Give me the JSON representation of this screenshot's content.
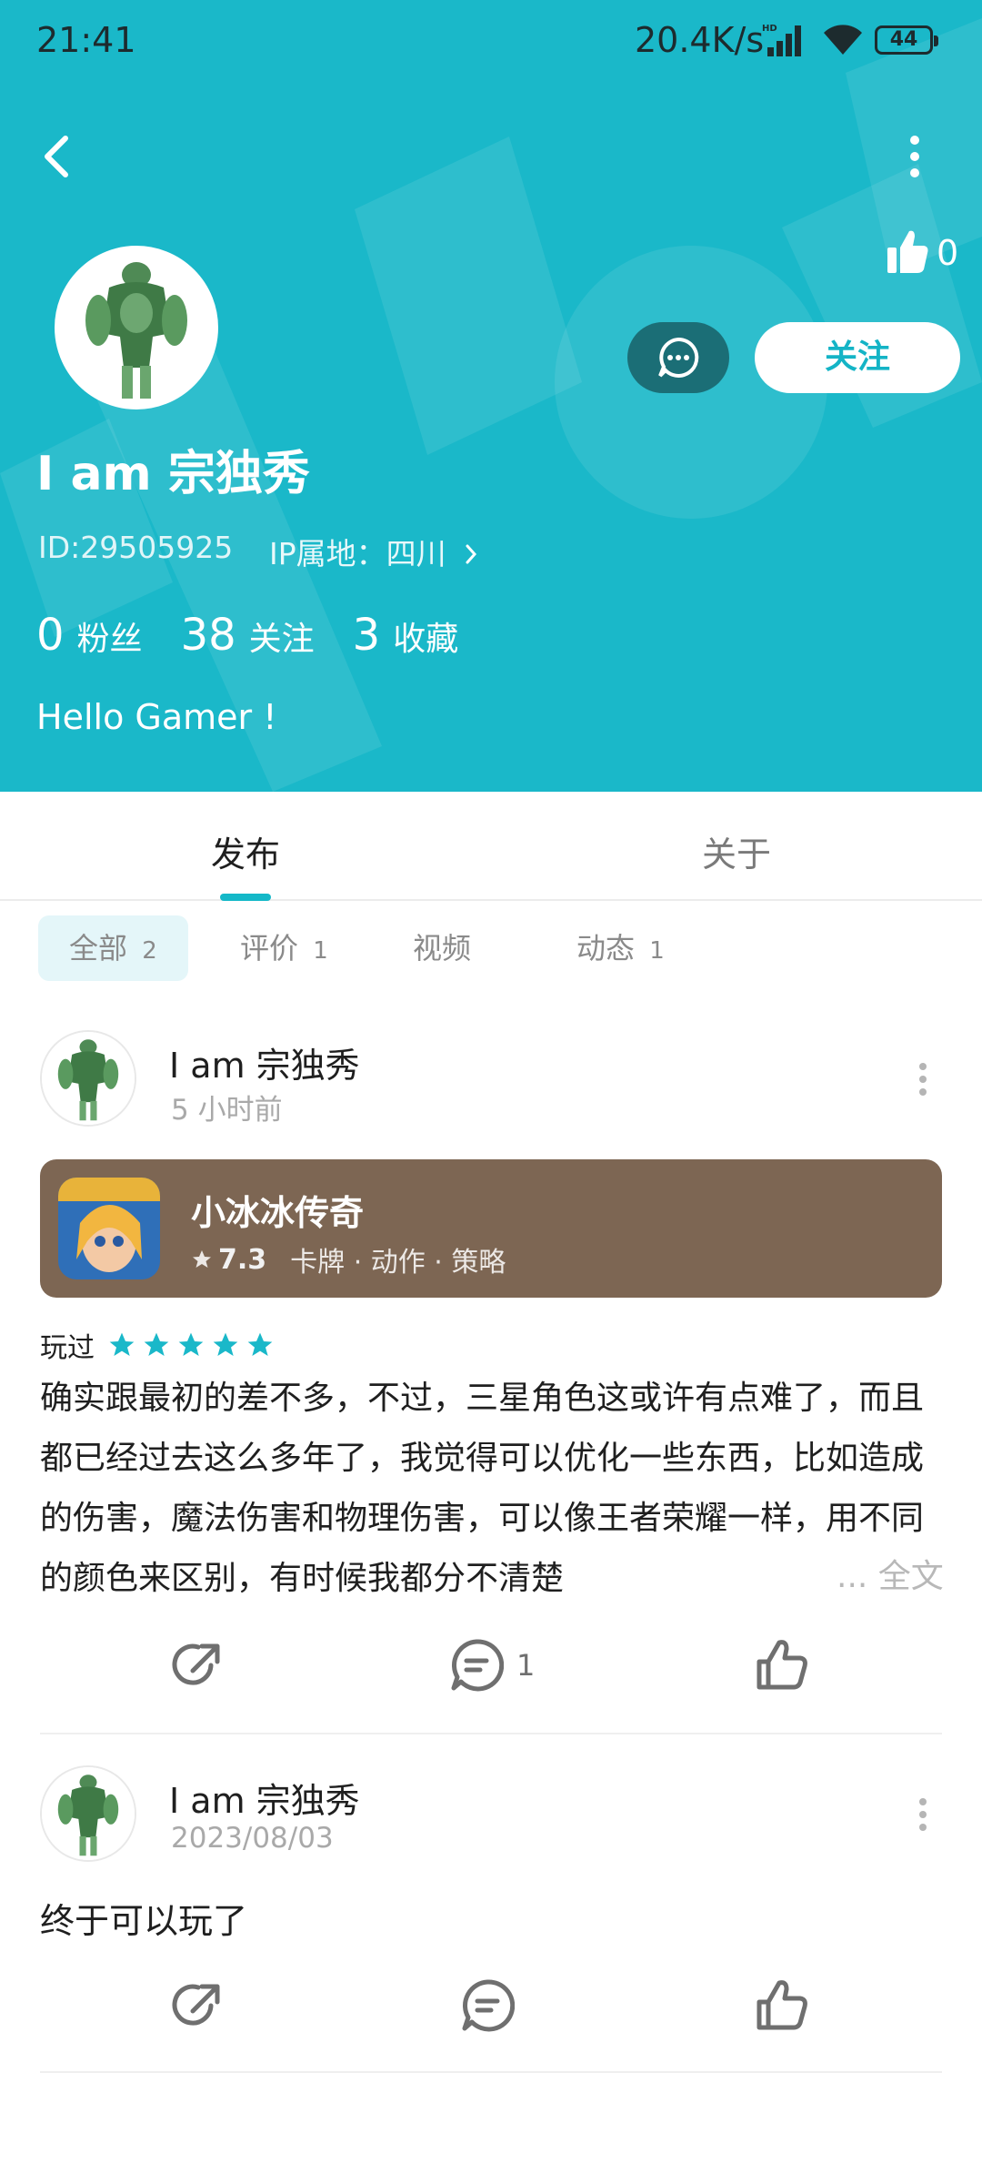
{
  "status_bar": {
    "time": "21:41",
    "net_speed": "20.4K/s",
    "battery": "44"
  },
  "colors": {
    "header_bg": "#1ab8c9",
    "accent": "#14b8c8",
    "game_card_bg": "#7d6653",
    "star": "#1ab8c9"
  },
  "header": {
    "like_count": "0",
    "follow_label": "关注",
    "icons": {
      "back": "chevron-left-icon",
      "more": "more-vertical-icon",
      "like": "thumbs-up-icon",
      "message": "chat-bubble-icon"
    }
  },
  "profile": {
    "name": "I am 宗独秀",
    "id_text": "ID:29505925",
    "ip_text": "IP属地：四川",
    "stats": [
      {
        "num": "0",
        "label": "粉丝"
      },
      {
        "num": "38",
        "label": "关注"
      },
      {
        "num": "3",
        "label": "收藏"
      }
    ],
    "bio": "Hello Gamer !"
  },
  "tabs": {
    "publish": "发布",
    "about": "关于"
  },
  "filters": [
    {
      "label": "全部",
      "count": "2"
    },
    {
      "label": "评价",
      "count": "1"
    },
    {
      "label": "视频",
      "count": ""
    },
    {
      "label": "动态",
      "count": "1"
    }
  ],
  "posts": [
    {
      "author": "I am 宗独秀",
      "time": "5 小时前",
      "game": {
        "name": "小冰冰传奇",
        "score": "7.3",
        "tags": "卡牌 · 动作 · 策略"
      },
      "played_label": "玩过",
      "rating": 5,
      "text": "确实跟最初的差不多，不过，三星角色这或许有点难了，而且都已经过去这么多年了，我觉得可以优化一些东西，比如造成的伤害，魔法伤害和物理伤害，可以像王者荣耀一样，用不同的颜色来区别，有时候我都分不清楚",
      "more_text": "... 全文",
      "comment_count": "1"
    },
    {
      "author": "I am 宗独秀",
      "time": "2023/08/03",
      "text": "终于可以玩了",
      "comment_count": ""
    }
  ]
}
